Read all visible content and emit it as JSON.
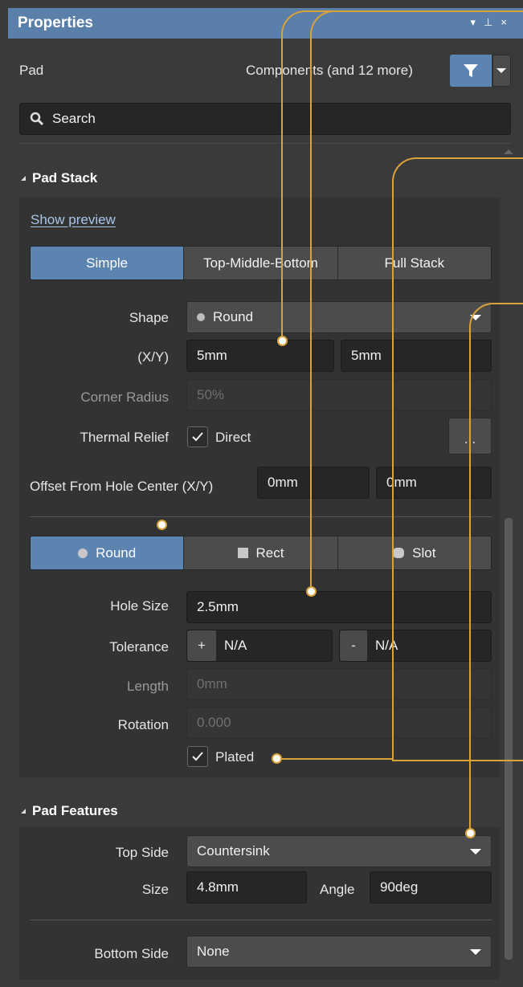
{
  "title": "Properties",
  "window_controls": [
    "▾",
    "⊥",
    "×"
  ],
  "header": {
    "object": "Pad",
    "filter_text": "Components (and 12 more)"
  },
  "search": {
    "placeholder": "Search"
  },
  "pad_stack": {
    "title": "Pad Stack",
    "show_preview": "Show preview",
    "modes": [
      "Simple",
      "Top-Middle-Bottom",
      "Full Stack"
    ],
    "active_mode": "Simple",
    "shape_label": "Shape",
    "shape_value": "Round",
    "xy_label": "(X/Y)",
    "x": "5mm",
    "y": "5mm",
    "corner_label": "Corner Radius",
    "corner_value": "50%",
    "thermal_label": "Thermal Relief",
    "thermal_value": "Direct",
    "thermal_btn": "...",
    "offset_label": "Offset From Hole Center (X/Y)",
    "offset_x": "0mm",
    "offset_y": "0mm",
    "hole_types": [
      "Round",
      "Rect",
      "Slot"
    ],
    "active_hole": "Round",
    "hole_size_label": "Hole Size",
    "hole_size": "2.5mm",
    "tolerance_label": "Tolerance",
    "tol_plus_sign": "+",
    "tol_plus": "N/A",
    "tol_minus_sign": "-",
    "tol_minus": "N/A",
    "length_label": "Length",
    "length": "0mm",
    "rotation_label": "Rotation",
    "rotation": "0.000",
    "plated": "Plated"
  },
  "pad_features": {
    "title": "Pad Features",
    "top_label": "Top Side",
    "top_value": "Countersink",
    "size_label": "Size",
    "size_value": "4.8mm",
    "angle_label": "Angle",
    "angle_value": "90deg",
    "bottom_label": "Bottom Side",
    "bottom_value": "None"
  },
  "colors": {
    "accent": "#5c84b0",
    "callout": "#d9a23a",
    "background": "#3a3a3a"
  }
}
